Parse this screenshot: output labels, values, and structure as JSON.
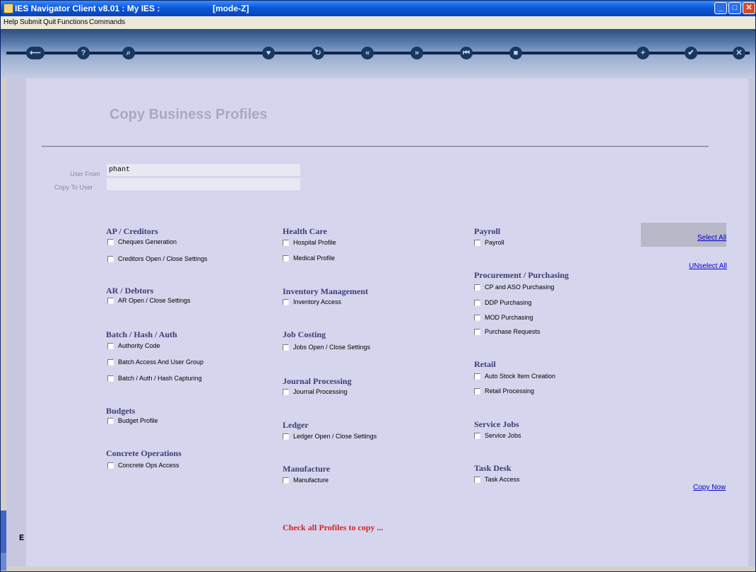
{
  "window": {
    "title": "IES Navigator Client v8.01 : My IES :",
    "mode": "[mode-Z]"
  },
  "menubar": {
    "items": [
      "Help",
      "Submit",
      "Quit",
      "Functions",
      "Commands"
    ]
  },
  "toolbar": {
    "buttons": [
      {
        "icon": "back-arrow-icon",
        "glyph": "⟵"
      },
      {
        "icon": "help-icon",
        "glyph": "?"
      },
      {
        "icon": "search-icon",
        "glyph": "⌕"
      },
      {
        "icon": "heart-icon",
        "glyph": "♥"
      },
      {
        "icon": "refresh-icon",
        "glyph": "↻"
      },
      {
        "icon": "rewind-icon",
        "glyph": "«"
      },
      {
        "icon": "forward-icon",
        "glyph": "»"
      },
      {
        "icon": "first-icon",
        "glyph": "⏮"
      },
      {
        "icon": "stop-icon",
        "glyph": "■"
      },
      {
        "icon": "add-icon",
        "glyph": "+"
      },
      {
        "icon": "check-icon",
        "glyph": "✔"
      },
      {
        "icon": "close-icon",
        "glyph": "✕"
      }
    ]
  },
  "page": {
    "heading": "Copy Business Profiles",
    "user_from_label": "User From",
    "user_from_value": "phant",
    "copy_to_label": "Copy To User",
    "copy_to_value": ""
  },
  "sections": {
    "ap": {
      "title": "AP / Creditors",
      "items": [
        "Cheques Generation",
        "Creditors Open / Close Settings"
      ]
    },
    "ar": {
      "title": "AR / Debtors",
      "items": [
        "AR Open / Close Settings"
      ]
    },
    "batch": {
      "title": "Batch / Hash / Auth",
      "items": [
        "Authority Code",
        "Batch Access And User Group",
        "Batch / Auth / Hash Capturing"
      ]
    },
    "budgets": {
      "title": "Budgets",
      "items": [
        "Budget Profile"
      ]
    },
    "concrete": {
      "title": "Concrete Operations",
      "items": [
        "Concrete Ops Access"
      ]
    },
    "health": {
      "title": "Health Care",
      "items": [
        "Hospital Profile",
        "Medical Profile"
      ]
    },
    "inventory": {
      "title": "Inventory Management",
      "items": [
        "Inventory Access"
      ]
    },
    "job": {
      "title": "Job Costing",
      "items": [
        "Jobs Open / Close Settings"
      ]
    },
    "journal": {
      "title": "Journal Processing",
      "items": [
        "Journal Processing"
      ]
    },
    "ledger": {
      "title": "Ledger",
      "items": [
        "Ledger Open / Close Settings"
      ]
    },
    "manufacture": {
      "title": "Manufacture",
      "items": [
        "Manufacture"
      ]
    },
    "payroll": {
      "title": "Payroll",
      "items": [
        "Payroll"
      ]
    },
    "procurement": {
      "title": "Procurement / Purchasing",
      "items": [
        "CP and ASO Purchasing",
        "DDP Purchasing",
        "MOD Purchasing",
        "Purchase Requests"
      ]
    },
    "retail": {
      "title": "Retail",
      "items": [
        "Auto Stock Item Creation",
        "Retail Processing"
      ]
    },
    "service": {
      "title": "Service Jobs",
      "items": [
        "Service Jobs"
      ]
    },
    "task": {
      "title": "Task Desk",
      "items": [
        "Task Access"
      ]
    }
  },
  "actions": {
    "select_all": "Select All",
    "unselect_all": "UNselect All",
    "copy_now": "Copy Now"
  },
  "message": "Check all Profiles to copy ...",
  "sidebar": {
    "letter": "E"
  }
}
